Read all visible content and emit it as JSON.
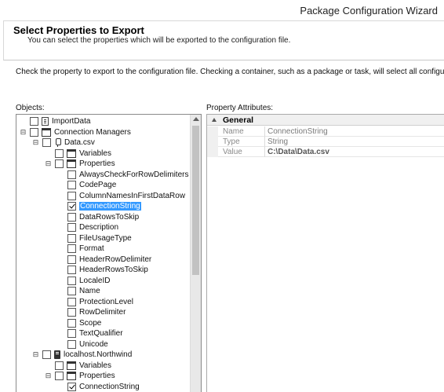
{
  "window": {
    "title": "Package Configuration Wizard"
  },
  "header": {
    "title": "Select Properties to Export",
    "subtitle": "You can select the properties which will be exported to the configuration file."
  },
  "instruction": "Check the property to export to the configuration file. Checking a container, such as a package or task, will select all configurable properti",
  "objects_label": "Objects:",
  "attributes_label": "Property Attributes:",
  "tree": [
    {
      "label": "ImportData",
      "level": 0,
      "expander": "",
      "checked": false,
      "icon": "package-icon"
    },
    {
      "label": "Connection Managers",
      "level": 0,
      "expander": "⊟",
      "checked": false,
      "icon": "folder-icon"
    },
    {
      "label": "Data.csv",
      "level": 1,
      "expander": "⊟",
      "checked": false,
      "icon": "connection-icon"
    },
    {
      "label": "Variables",
      "level": 2,
      "expander": "",
      "checked": false,
      "icon": "folder-icon"
    },
    {
      "label": "Properties",
      "level": 2,
      "expander": "⊟",
      "checked": false,
      "icon": "folder-icon"
    },
    {
      "label": "AlwaysCheckForRowDelimiters",
      "level": 3,
      "expander": "",
      "checked": false,
      "icon": ""
    },
    {
      "label": "CodePage",
      "level": 3,
      "expander": "",
      "checked": false,
      "icon": ""
    },
    {
      "label": "ColumnNamesInFirstDataRow",
      "level": 3,
      "expander": "",
      "checked": false,
      "icon": ""
    },
    {
      "label": "ConnectionString",
      "level": 3,
      "expander": "",
      "checked": true,
      "icon": "",
      "selected": true
    },
    {
      "label": "DataRowsToSkip",
      "level": 3,
      "expander": "",
      "checked": false,
      "icon": ""
    },
    {
      "label": "Description",
      "level": 3,
      "expander": "",
      "checked": false,
      "icon": ""
    },
    {
      "label": "FileUsageType",
      "level": 3,
      "expander": "",
      "checked": false,
      "icon": ""
    },
    {
      "label": "Format",
      "level": 3,
      "expander": "",
      "checked": false,
      "icon": ""
    },
    {
      "label": "HeaderRowDelimiter",
      "level": 3,
      "expander": "",
      "checked": false,
      "icon": ""
    },
    {
      "label": "HeaderRowsToSkip",
      "level": 3,
      "expander": "",
      "checked": false,
      "icon": ""
    },
    {
      "label": "LocaleID",
      "level": 3,
      "expander": "",
      "checked": false,
      "icon": ""
    },
    {
      "label": "Name",
      "level": 3,
      "expander": "",
      "checked": false,
      "icon": ""
    },
    {
      "label": "ProtectionLevel",
      "level": 3,
      "expander": "",
      "checked": false,
      "icon": ""
    },
    {
      "label": "RowDelimiter",
      "level": 3,
      "expander": "",
      "checked": false,
      "icon": ""
    },
    {
      "label": "Scope",
      "level": 3,
      "expander": "",
      "checked": false,
      "icon": ""
    },
    {
      "label": "TextQualifier",
      "level": 3,
      "expander": "",
      "checked": false,
      "icon": ""
    },
    {
      "label": "Unicode",
      "level": 3,
      "expander": "",
      "checked": false,
      "icon": ""
    },
    {
      "label": "localhost.Northwind",
      "level": 1,
      "expander": "⊟",
      "checked": false,
      "icon": "server-icon"
    },
    {
      "label": "Variables",
      "level": 2,
      "expander": "",
      "checked": false,
      "icon": "folder-icon"
    },
    {
      "label": "Properties",
      "level": 2,
      "expander": "⊟",
      "checked": false,
      "icon": "folder-icon"
    },
    {
      "label": "ConnectionString",
      "level": 3,
      "expander": "",
      "checked": true,
      "icon": ""
    }
  ],
  "attributes": {
    "group": "General",
    "rows": [
      {
        "key": "Name",
        "value": "ConnectionString",
        "bold": false
      },
      {
        "key": "Type",
        "value": "String",
        "bold": false
      },
      {
        "key": "Value",
        "value": "C:\\Data\\Data.csv",
        "bold": true
      }
    ]
  }
}
